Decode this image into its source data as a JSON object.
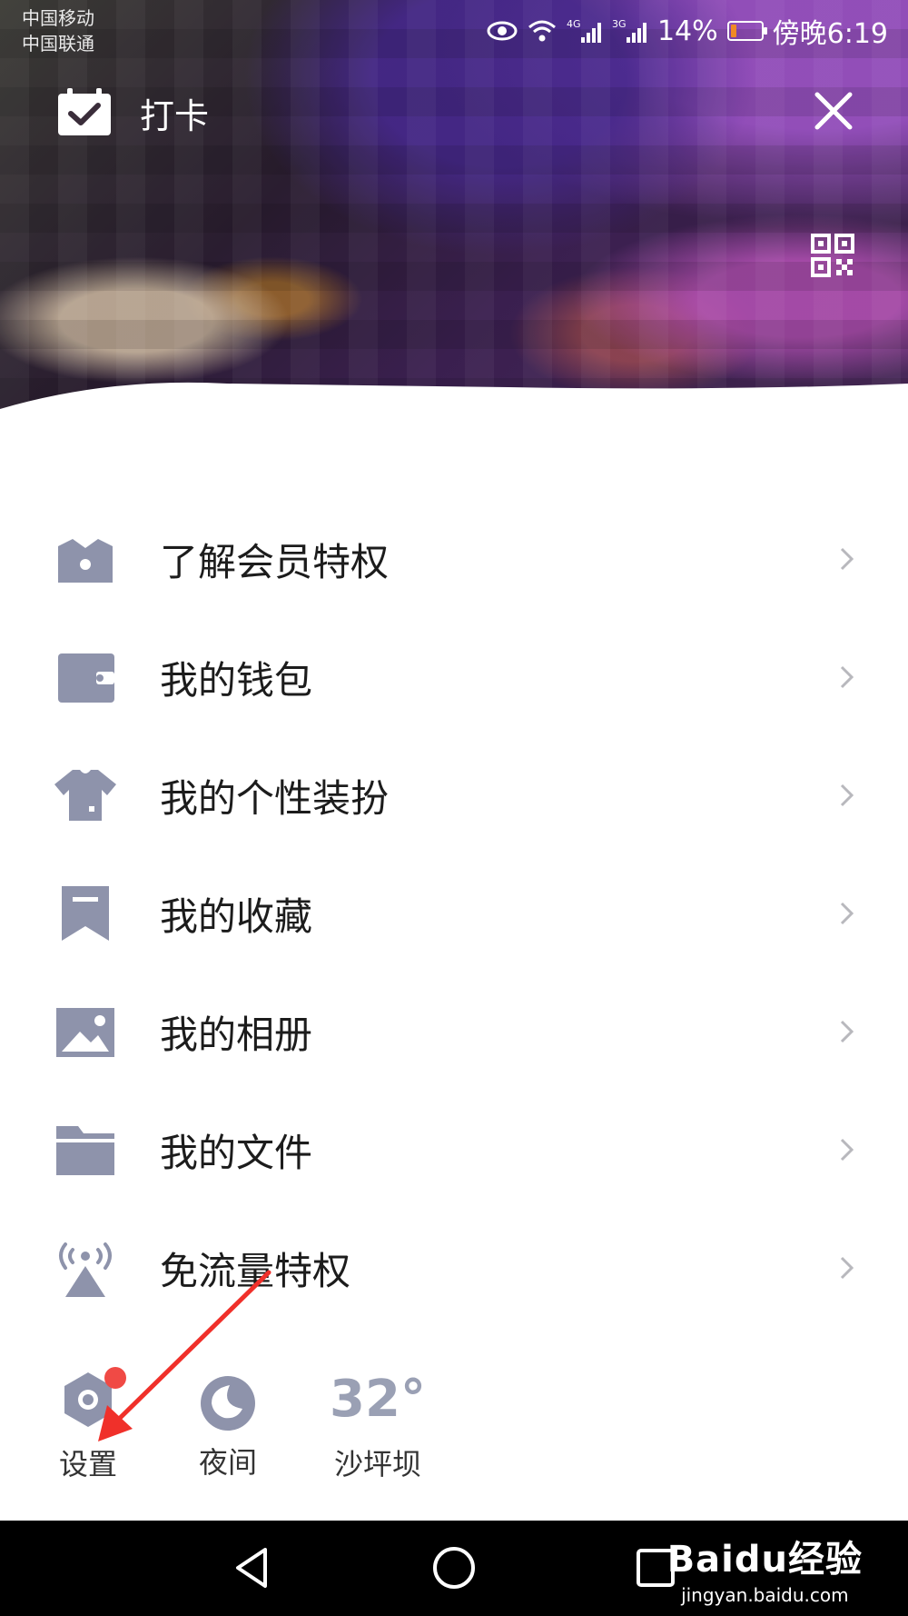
{
  "status_bar": {
    "carrier_1": "中国移动",
    "carrier_2": "中国联通",
    "net_4g": "4G",
    "net_3g": "3G",
    "battery": "14%",
    "time": "傍晚6:19"
  },
  "header": {
    "checkin_label": "打卡"
  },
  "menu": {
    "items": [
      {
        "label": "了解会员特权",
        "icon": "vip-crown-icon"
      },
      {
        "label": "我的钱包",
        "icon": "wallet-icon"
      },
      {
        "label": "我的个性装扮",
        "icon": "tshirt-icon"
      },
      {
        "label": "我的收藏",
        "icon": "bookmark-icon"
      },
      {
        "label": "我的相册",
        "icon": "photo-album-icon"
      },
      {
        "label": "我的文件",
        "icon": "folder-icon"
      },
      {
        "label": "免流量特权",
        "icon": "broadcast-tower-icon"
      }
    ]
  },
  "bottom": {
    "settings_label": "设置",
    "night_label": "夜间",
    "temperature": "32°",
    "location": "沙坪坝"
  },
  "watermark": {
    "logo_text": "Baidu经验",
    "url": "jingyan.baidu.com"
  },
  "colors": {
    "icon_gray": "#8e93ab",
    "red_dot": "#f04a45",
    "arrow_red": "#f0302a"
  }
}
